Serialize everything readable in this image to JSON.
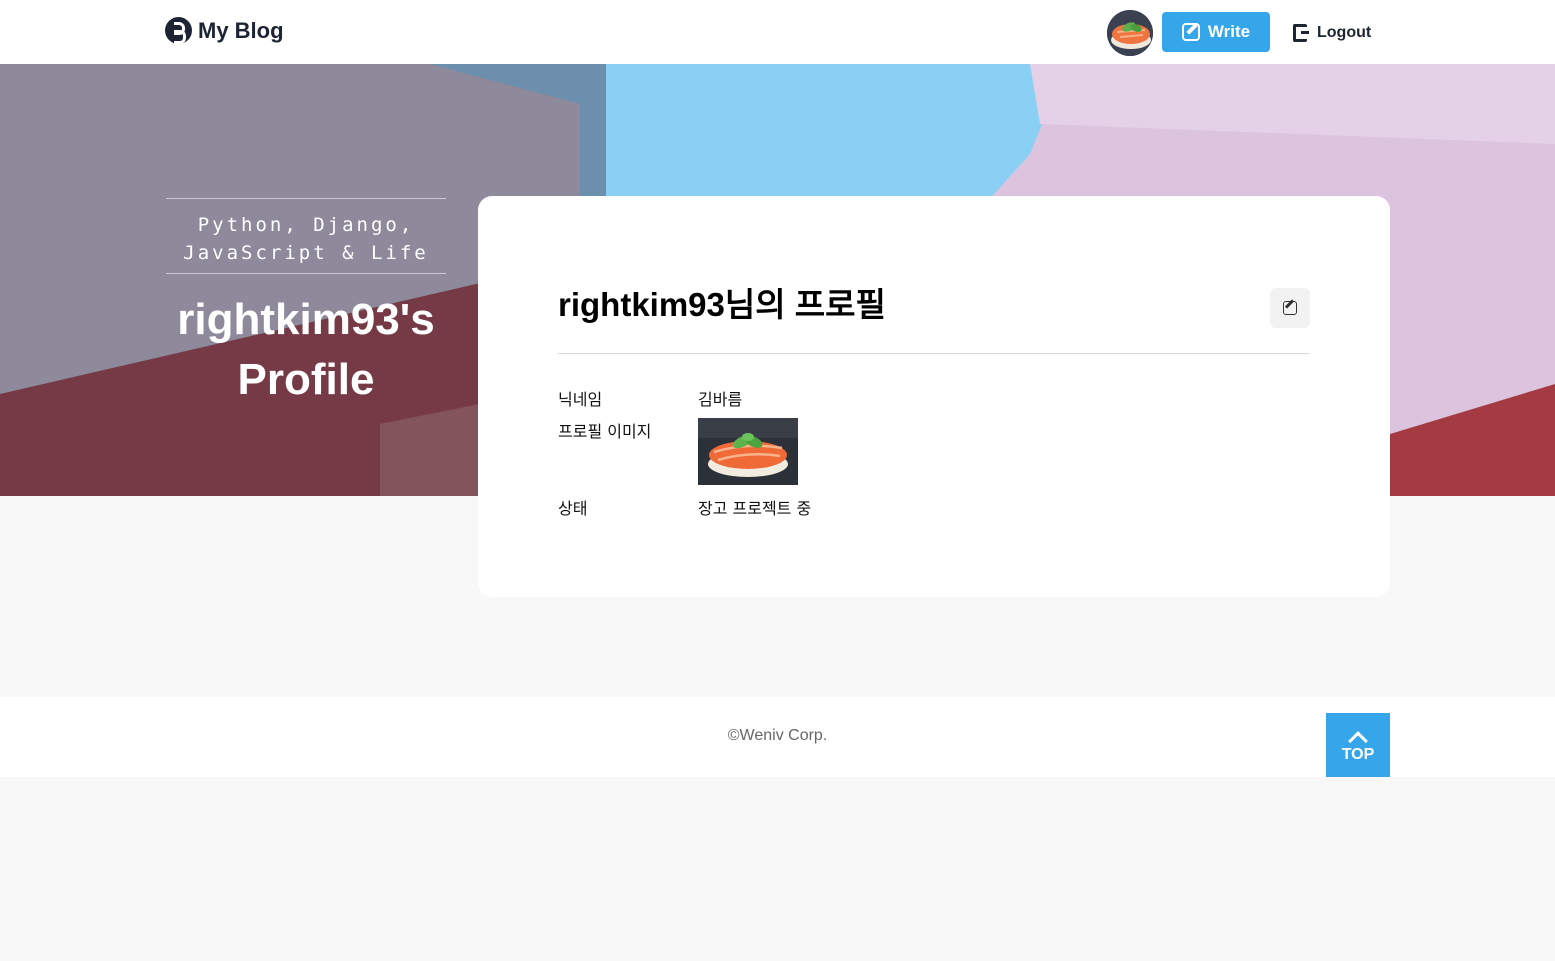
{
  "header": {
    "logo_text": "My Blog",
    "write_label": "Write",
    "logout_label": "Logout"
  },
  "hero": {
    "subtitle_line1": "Python, Django,",
    "subtitle_line2": "JavaScript & Life",
    "title_line1": "rightkim93's",
    "title_line2": "Profile"
  },
  "profile": {
    "heading": "rightkim93님의 프로필",
    "nickname_label": "닉네임",
    "nickname_value": "김바름",
    "image_label": "프로필 이미지",
    "status_label": "상태",
    "status_value": "장고 프로젝트 중"
  },
  "footer": {
    "copyright": "©Weniv Corp.",
    "top_label": "TOP"
  },
  "colors": {
    "accent": "#35a6ea",
    "brand_dark": "#1d2433"
  }
}
